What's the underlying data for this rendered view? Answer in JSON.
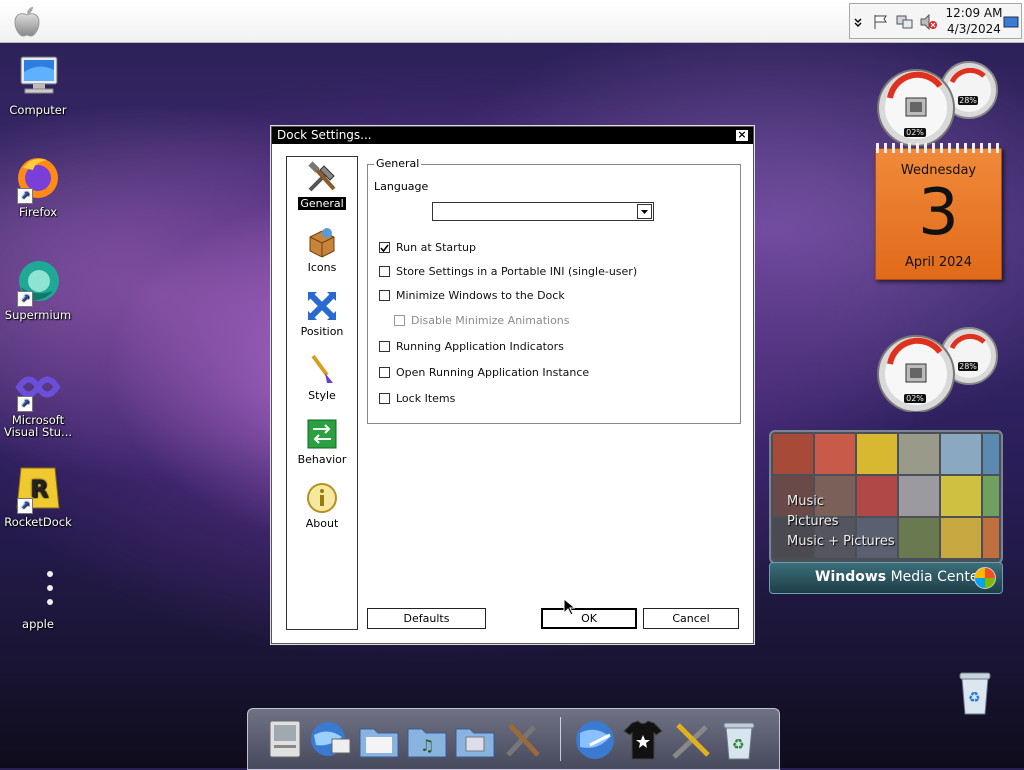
{
  "topbar": {
    "apple_menu": "apple-logo"
  },
  "tray": {
    "icons": [
      "chevron-down-icon",
      "flag-icon",
      "network-icon",
      "volume-muted-icon",
      "show-desktop-icon"
    ],
    "time": "12:09 AM",
    "date": "4/3/2024"
  },
  "desktop": {
    "icons": [
      {
        "label": "Computer"
      },
      {
        "label": "Firefox"
      },
      {
        "label": "Supermium"
      },
      {
        "label": "Microsoft Visual Stu..."
      },
      {
        "label": "RocketDock"
      },
      {
        "label": "apple"
      }
    ]
  },
  "dialog": {
    "title": "Dock Settings...",
    "close": "×",
    "nav": [
      {
        "label": "General",
        "selected": true
      },
      {
        "label": "Icons"
      },
      {
        "label": "Position"
      },
      {
        "label": "Style"
      },
      {
        "label": "Behavior"
      },
      {
        "label": "About"
      }
    ],
    "group_title": "General",
    "language_label": "Language",
    "language_value": "",
    "options": [
      {
        "label": "Run at Startup",
        "checked": true
      },
      {
        "label": "Store Settings in a Portable INI (single-user)",
        "checked": false
      },
      {
        "label": "Minimize Windows to the Dock",
        "checked": false
      },
      {
        "label": "Disable Minimize Animations",
        "checked": false,
        "disabled": true
      },
      {
        "label": "Running Application Indicators",
        "checked": false
      },
      {
        "label": "Open Running Application Instance",
        "checked": false
      },
      {
        "label": "Lock Items",
        "checked": false
      }
    ],
    "buttons": {
      "defaults": "Defaults",
      "ok": "OK",
      "cancel": "Cancel"
    }
  },
  "gadgets": {
    "calendar": {
      "weekday": "Wednesday",
      "day": "3",
      "month": "April 2024"
    },
    "meter_1": {
      "cpu_readout": "02%",
      "ram_readout": "28%"
    },
    "meter_2": {
      "cpu_readout": "02%",
      "ram_readout": "28%"
    },
    "media_center": {
      "menu": [
        "Music",
        "Pictures",
        "Music + Pictures"
      ],
      "brand_bold": "Windows",
      "brand_rest": " Media Center"
    }
  },
  "dock": {
    "items": [
      "finder-icon",
      "network-globe-icon",
      "folder-documents-icon",
      "folder-music-icon",
      "folder-pictures-icon",
      "settings-tools-icon",
      "browser-globe-icon",
      "tshirt-icon",
      "rocketdock-settings-icon",
      "recycle-bin-icon"
    ]
  },
  "colors": {
    "calendar_orange": "#e8782a",
    "dialog_title": "#000000",
    "wmc_teal": "#2d5a66"
  }
}
